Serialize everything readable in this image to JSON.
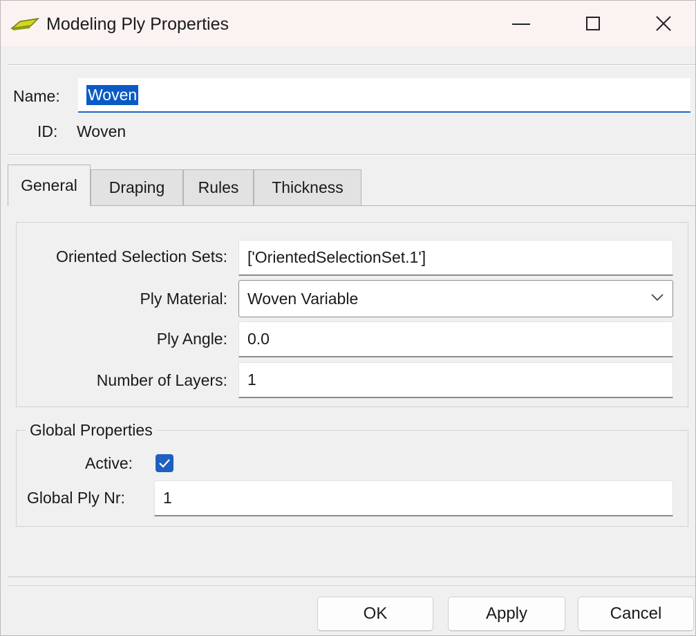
{
  "window": {
    "title": "Modeling Ply Properties",
    "icon": "ply-icon"
  },
  "header": {
    "name_label": "Name:",
    "name_value": "Woven",
    "id_label": "ID:",
    "id_value": "Woven"
  },
  "tabs": [
    {
      "label": "General",
      "active": true
    },
    {
      "label": "Draping",
      "active": false
    },
    {
      "label": "Rules",
      "active": false
    },
    {
      "label": "Thickness",
      "active": false
    }
  ],
  "general": {
    "oriented_selection_sets_label": "Oriented Selection Sets:",
    "oriented_selection_sets_value": "['OrientedSelectionSet.1']",
    "ply_material_label": "Ply Material:",
    "ply_material_value": "Woven Variable",
    "ply_angle_label": "Ply Angle:",
    "ply_angle_value": "0.0",
    "number_of_layers_label": "Number of Layers:",
    "number_of_layers_value": "1"
  },
  "global_properties": {
    "title": "Global Properties",
    "active_label": "Active:",
    "active_checked": true,
    "global_ply_nr_label": "Global Ply Nr:",
    "global_ply_nr_value": "1"
  },
  "buttons": {
    "ok": "OK",
    "apply": "Apply",
    "cancel": "Cancel"
  },
  "colors": {
    "accent": "#1f5fbf",
    "titlebar": "#fbf3f1",
    "background": "#f0f0f0"
  }
}
